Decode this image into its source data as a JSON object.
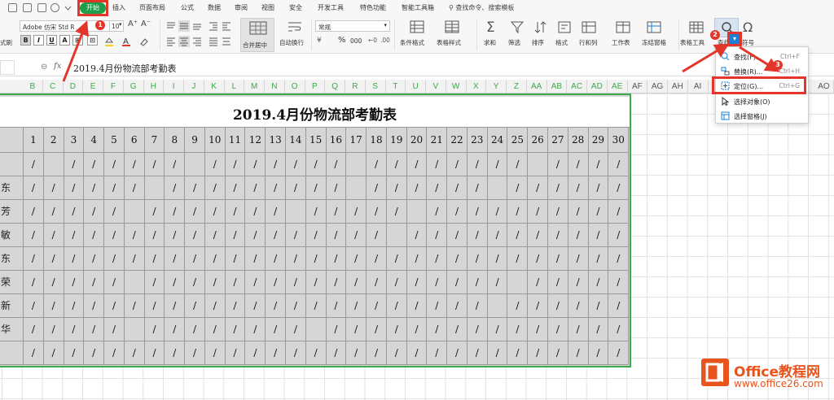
{
  "menubar": {
    "tabs": [
      "开始",
      "插入",
      "页面布局",
      "公式",
      "数据",
      "审阅",
      "视图",
      "安全",
      "开发工具",
      "特色功能",
      "智能工具箱"
    ],
    "command_search": "查找命令、搜索模板"
  },
  "ribbon": {
    "font_name": "Adobe 仿宋 Std R",
    "font_size": "10",
    "format_type": "常规",
    "merge_center": "合并居中",
    "wrap_text": "自动换行",
    "percent": "%",
    "thousands": "000",
    "labels_left": [
      "式刷"
    ],
    "conditional_format": "条件格式",
    "table_style": "表格样式",
    "sum": "求和",
    "filter": "筛选",
    "sort": "排序",
    "format": "格式",
    "row_col": "行和列",
    "worksheet": "工作表",
    "freeze": "冻结窗格",
    "table_tools": "表格工具",
    "find": "查找",
    "symbol": "符号"
  },
  "formula_bar": {
    "fx": "fx",
    "content": "2019.4月份物流部考勤表"
  },
  "columns": [
    "B",
    "C",
    "D",
    "E",
    "F",
    "G",
    "H",
    "I",
    "J",
    "K",
    "L",
    "M",
    "N",
    "O",
    "P",
    "Q",
    "R",
    "S",
    "T",
    "U",
    "V",
    "W",
    "X",
    "Y",
    "Z",
    "AA",
    "AB",
    "AC",
    "AD",
    "AE",
    "AF",
    "AG",
    "AH",
    "AI",
    "AO"
  ],
  "sheet": {
    "title": "2019.4月份物流部考勤表",
    "days": [
      "1",
      "2",
      "3",
      "4",
      "5",
      "6",
      "7",
      "8",
      "9",
      "10",
      "11",
      "12",
      "13",
      "14",
      "15",
      "16",
      "17",
      "18",
      "19",
      "20",
      "21",
      "22",
      "23",
      "24",
      "25",
      "26",
      "27",
      "28",
      "29",
      "30"
    ],
    "row_names": [
      "",
      "东",
      "芳",
      "敏",
      "东",
      "荣",
      "新",
      "华",
      ""
    ],
    "mark": "/",
    "rows": [
      [
        1,
        0,
        1,
        1,
        1,
        1,
        1,
        1,
        0,
        1,
        1,
        1,
        1,
        1,
        1,
        1,
        0,
        1,
        1,
        1,
        1,
        1,
        1,
        1,
        1,
        0,
        1,
        1,
        1,
        1
      ],
      [
        1,
        1,
        1,
        1,
        1,
        1,
        0,
        1,
        1,
        1,
        1,
        1,
        1,
        1,
        1,
        1,
        0,
        1,
        1,
        1,
        1,
        1,
        1,
        0,
        1,
        1,
        1,
        1,
        1,
        1
      ],
      [
        1,
        1,
        1,
        1,
        1,
        0,
        1,
        1,
        1,
        1,
        1,
        1,
        1,
        0,
        1,
        1,
        1,
        1,
        1,
        0,
        1,
        1,
        1,
        1,
        1,
        1,
        1,
        1,
        1,
        1
      ],
      [
        1,
        1,
        1,
        1,
        1,
        1,
        1,
        1,
        1,
        1,
        1,
        1,
        1,
        1,
        1,
        1,
        1,
        1,
        0,
        1,
        1,
        1,
        1,
        1,
        1,
        1,
        1,
        1,
        1,
        1
      ],
      [
        1,
        1,
        1,
        1,
        1,
        1,
        1,
        1,
        1,
        1,
        1,
        1,
        1,
        1,
        1,
        1,
        1,
        1,
        1,
        1,
        1,
        1,
        1,
        1,
        1,
        1,
        1,
        1,
        1,
        1
      ],
      [
        1,
        1,
        1,
        1,
        1,
        0,
        1,
        1,
        1,
        1,
        1,
        1,
        1,
        1,
        1,
        1,
        1,
        1,
        1,
        1,
        1,
        1,
        1,
        1,
        0,
        1,
        1,
        1,
        1,
        1
      ],
      [
        1,
        1,
        1,
        1,
        1,
        1,
        1,
        1,
        1,
        1,
        1,
        1,
        1,
        1,
        1,
        1,
        1,
        1,
        1,
        1,
        1,
        1,
        1,
        0,
        1,
        1,
        1,
        1,
        1,
        1
      ],
      [
        1,
        1,
        1,
        1,
        1,
        0,
        1,
        1,
        1,
        1,
        1,
        1,
        1,
        1,
        0,
        1,
        1,
        1,
        1,
        1,
        1,
        1,
        1,
        1,
        1,
        1,
        1,
        1,
        1,
        1
      ],
      [
        1,
        1,
        1,
        1,
        1,
        1,
        1,
        1,
        1,
        1,
        1,
        1,
        1,
        1,
        1,
        1,
        1,
        1,
        1,
        1,
        1,
        1,
        1,
        1,
        1,
        1,
        1,
        1,
        1,
        1
      ]
    ]
  },
  "find_menu": {
    "items": [
      {
        "label": "查找(F)...",
        "shortcut": "Ctrl+F"
      },
      {
        "label": "替换(R)...",
        "shortcut": "Ctrl+H"
      },
      {
        "label": "定位(G)...",
        "shortcut": "Ctrl+G"
      },
      {
        "label": "选择对象(O)",
        "shortcut": ""
      },
      {
        "label": "选择窗格(J)",
        "shortcut": ""
      }
    ]
  },
  "annotations": [
    "1",
    "2",
    "3"
  ],
  "colors": {
    "accent_green": "#1e9e4a",
    "annotation_red": "#e4352b",
    "watermark_orange": "#e8541e"
  },
  "watermark": {
    "title": "Office教程网",
    "url": "www.office26.com"
  }
}
